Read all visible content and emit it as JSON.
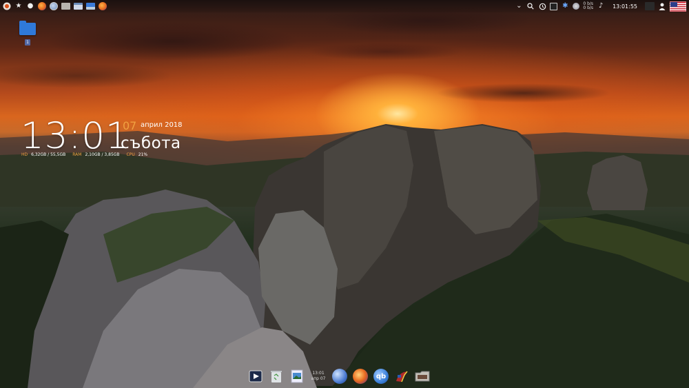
{
  "desktop": {
    "wallpaper": "sunset-over-sandstone-rocks",
    "folder": {
      "icon": "folder-icon",
      "badge": "1"
    }
  },
  "top_panel": {
    "left_icons": [
      "app-menu-icon",
      "favorites-star-icon",
      "dot-icon",
      "firefox-icon",
      "globe-icon",
      "file-manager-icon",
      "window-icon",
      "desktop-icon",
      "firefox-icon"
    ],
    "right_icons": [
      "chevron-down-icon",
      "search-icon",
      "history-icon",
      "system-monitor-icon",
      "bluetooth-icon",
      "network-icon",
      "volume-icon",
      "power-icon",
      "user-icon",
      "us-flag-icon"
    ],
    "net_speed_up": "0 b/s",
    "net_speed_down": "0 b/s",
    "clock": "13:01:55"
  },
  "clock_widget": {
    "time": "13:01",
    "day": "07",
    "month_year": "април 2018",
    "weekday": "събота",
    "stats": [
      {
        "label": "HD",
        "value": "6,32GB / 55,5GB"
      },
      {
        "label": "RAM",
        "value": "2,10GB / 3,85GB"
      },
      {
        "label": "CPU",
        "value": "21%"
      }
    ]
  },
  "dock": {
    "items": [
      "media-player-icon",
      "trash-icon",
      "image-viewer-icon",
      "dock-clock",
      "globe-icon",
      "firefox-icon",
      "qbittorrent-icon",
      "wine-icon",
      "folder-icon"
    ],
    "clock_time": "13:01",
    "clock_date": "апр 07"
  },
  "colors": {
    "accent": "#f0a040",
    "folder": "#2f79d9",
    "qbittorrent": "#3b7fd8",
    "firefox": "#e66a1f"
  }
}
